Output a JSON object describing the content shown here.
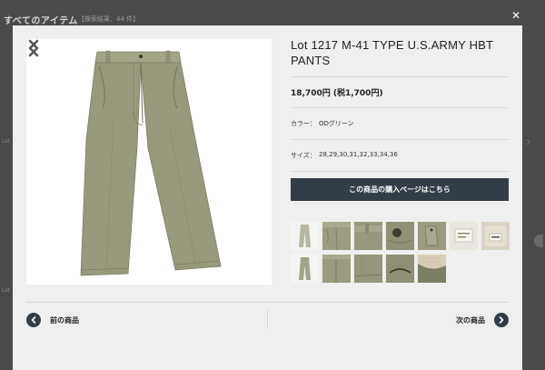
{
  "background": {
    "title": "すべてのアイテム",
    "count_label": "【検索結果：44 件】",
    "edge_labels": [
      "Lot",
      "Lot",
      "フ"
    ]
  },
  "modal": {
    "product": {
      "title": "Lot 1217 M-41 TYPE U.S.ARMY HBT PANTS",
      "price": "18,700円 (税1,700円)",
      "color_label": "カラー：",
      "color_value": "ODグリーン",
      "size_label": "サイズ：",
      "size_value": "28,29,30,31,32,33,34,36"
    },
    "buy_button": "この商品の購入ページはこちら",
    "nav": {
      "prev": "前の商品",
      "next": "次の商品"
    },
    "thumbnails": [
      {
        "name": "full-front"
      },
      {
        "name": "front-detail"
      },
      {
        "name": "waist-detail"
      },
      {
        "name": "back-pocket"
      },
      {
        "name": "pocket-detail"
      },
      {
        "name": "label-detail"
      },
      {
        "name": "size-tag"
      },
      {
        "name": "full-back"
      },
      {
        "name": "seat-detail"
      },
      {
        "name": "hem-detail"
      },
      {
        "name": "button-detail"
      },
      {
        "name": "lining-detail"
      }
    ]
  },
  "colors": {
    "accent": "#333d47",
    "fabric": "#9c9c7e"
  },
  "icons": {
    "close": "close-icon",
    "prev_image": "chevron-left-icon",
    "next_image": "chevron-right-icon",
    "prev_product": "circle-chevron-left-icon",
    "next_product": "circle-chevron-right-icon"
  }
}
